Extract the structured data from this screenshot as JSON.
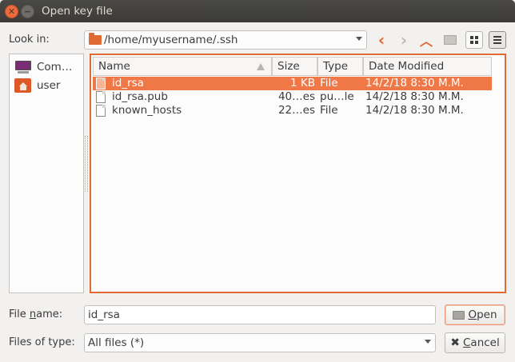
{
  "window": {
    "title": "Open key file"
  },
  "lookin": {
    "label": "Look in:",
    "path": "/home/myusername/.ssh"
  },
  "sidebar": {
    "items": [
      {
        "label": "Com…",
        "icon": "computer-icon"
      },
      {
        "label": "user",
        "icon": "home-folder-icon"
      }
    ]
  },
  "columns": {
    "name": "Name",
    "size": "Size",
    "type": "Type",
    "date": "Date Modified"
  },
  "files": [
    {
      "name": "id_rsa",
      "size": "1 KB",
      "type": "File",
      "date": "14/2/18 8:30 M.M.",
      "selected": true
    },
    {
      "name": "id_rsa.pub",
      "size": "40…es",
      "type": "pu…le",
      "date": "14/2/18 8:30 M.M.",
      "selected": false
    },
    {
      "name": "known_hosts",
      "size": "22…es",
      "type": "File",
      "date": "14/2/18 8:30 M.M.",
      "selected": false
    }
  ],
  "filename": {
    "label_pre": "File ",
    "label_ul": "n",
    "label_post": "ame:",
    "value": "id_rsa"
  },
  "filetype": {
    "label": "Files of type:",
    "value": "All files (*)"
  },
  "buttons": {
    "open_ul": "O",
    "open_rest": "pen",
    "cancel_ul": "C",
    "cancel_rest": "ancel"
  },
  "colors": {
    "accent": "#f07746",
    "title_bg": "#3c3b37",
    "close": "#ef6a3a"
  }
}
